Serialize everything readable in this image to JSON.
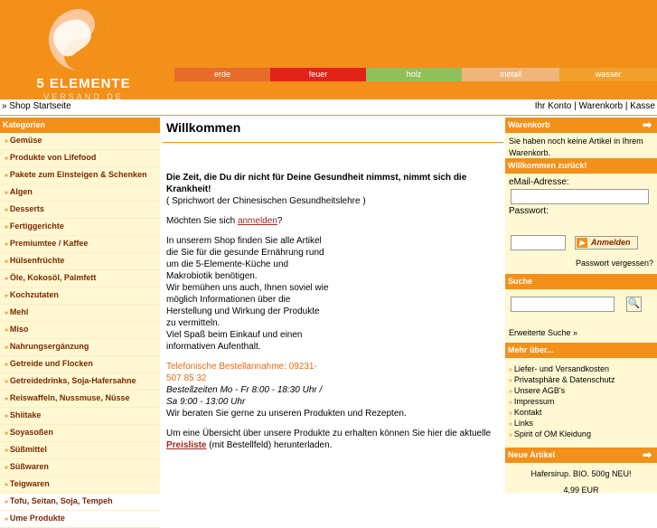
{
  "logo": {
    "title": "5 ELEMENTE",
    "subtitle": "VERSAND.DE"
  },
  "elements": [
    {
      "label": "erde",
      "color": "#e76b2a"
    },
    {
      "label": "feuer",
      "color": "#e2231a"
    },
    {
      "label": "holz",
      "color": "#8fc15a"
    },
    {
      "label": "metall",
      "color": "#f0b57a"
    },
    {
      "label": "wasser",
      "color": "#f2a02e"
    }
  ],
  "breadcrumb": {
    "home": "» Shop Startseite"
  },
  "account_links": [
    "Ihr Konto",
    "|",
    "Warenkorb",
    "|",
    "Kasse"
  ],
  "categories": {
    "title": "Kategorien",
    "items": [
      "Gemüse",
      "Produkte von Lifefood",
      "Pakete zum Einsteigen & Schenken",
      "Algen",
      "Desserts",
      "Fertiggerichte",
      "Premiumtee / Kaffee",
      "Hülsenfrüchte",
      "Öle, Kokosöl, Palmfett",
      "Kochzutaten",
      "Mehl",
      "Miso",
      "Nahrungsergänzung",
      "Getreide und Flocken",
      "Getreidedrinks, Soja-Hafersahne",
      "Reiswaffeln, Nussmuse, Nüsse",
      "Shiitake",
      "Soyasoßen",
      "Süßmittel",
      "Süßwaren",
      "Teigwaren",
      "Tofu, Seitan, Soja, Tempeh",
      "Ume Produkte"
    ]
  },
  "main": {
    "heading": "Willkommen",
    "quote": "Die Zeit, die Du dir nicht für Deine Gesundheit nimmst, nimmt sich die Krankheit!",
    "quote_source": "( Sprichwort der Chinesischen Gesundheitslehre )",
    "login_prefix": "Möchten Sie sich ",
    "login_link": "anmelden",
    "login_suffix": "?",
    "intro_lines": [
      "In unserem Shop finden Sie alle Artikel",
      "die Sie für die gesunde Ernährung rund",
      "um die 5-Elemente-Küche und",
      "Makrobiotik benötigen.",
      "Wir bemühen uns auch, Ihnen soviel wie",
      "möglich Informationen über die",
      "Herstellung und Wirkung der Produkte",
      "zu vermitteln.",
      "Viel Spaß beim Einkauf und einen",
      "informativen Aufenthalt."
    ],
    "tel_line1": "Telefonische Bestellannahme: 09231-",
    "tel_line2": "507 85 32",
    "hours_line1": "Bestellzeiten Mo - Fr 8:00 - 18:30 Uhr /",
    "hours_line2": "Sa 9:00 - 13:00 Uhr",
    "advice": "Wir beraten Sie gerne zu unseren Produkten und Rezepten.",
    "overview": "Um eine Übersicht über unsere Produkte zu erhalten können Sie hier die aktuelle",
    "pricelist_link": "Preisliste",
    "overview_suffix": " (mit Bestellfeld) herunterladen."
  },
  "cart": {
    "title": "Warenkorb",
    "text": "Sie haben noch keine Artikel in Ihrem Warenkorb."
  },
  "login": {
    "title": "Willkommen zurück!",
    "email_label": "eMail-Adresse:",
    "password_label": "Passwort:",
    "button": "Anmelden",
    "forgot": "Passwort vergessen?"
  },
  "search": {
    "title": "Suche",
    "advanced": "Erweiterte Suche »"
  },
  "more": {
    "title": "Mehr über...",
    "items": [
      "Liefer- und Versandkosten",
      "Privatsphäre & Datenschutz",
      "Unsere AGB's",
      "Impressum",
      "Kontakt",
      "Links",
      "Spirit of OM Kleidung"
    ]
  },
  "new_products": {
    "title": "Neue Artikel",
    "product": "Hafersirup. BIO. 500g NEU!",
    "price": "4,99 EUR"
  }
}
